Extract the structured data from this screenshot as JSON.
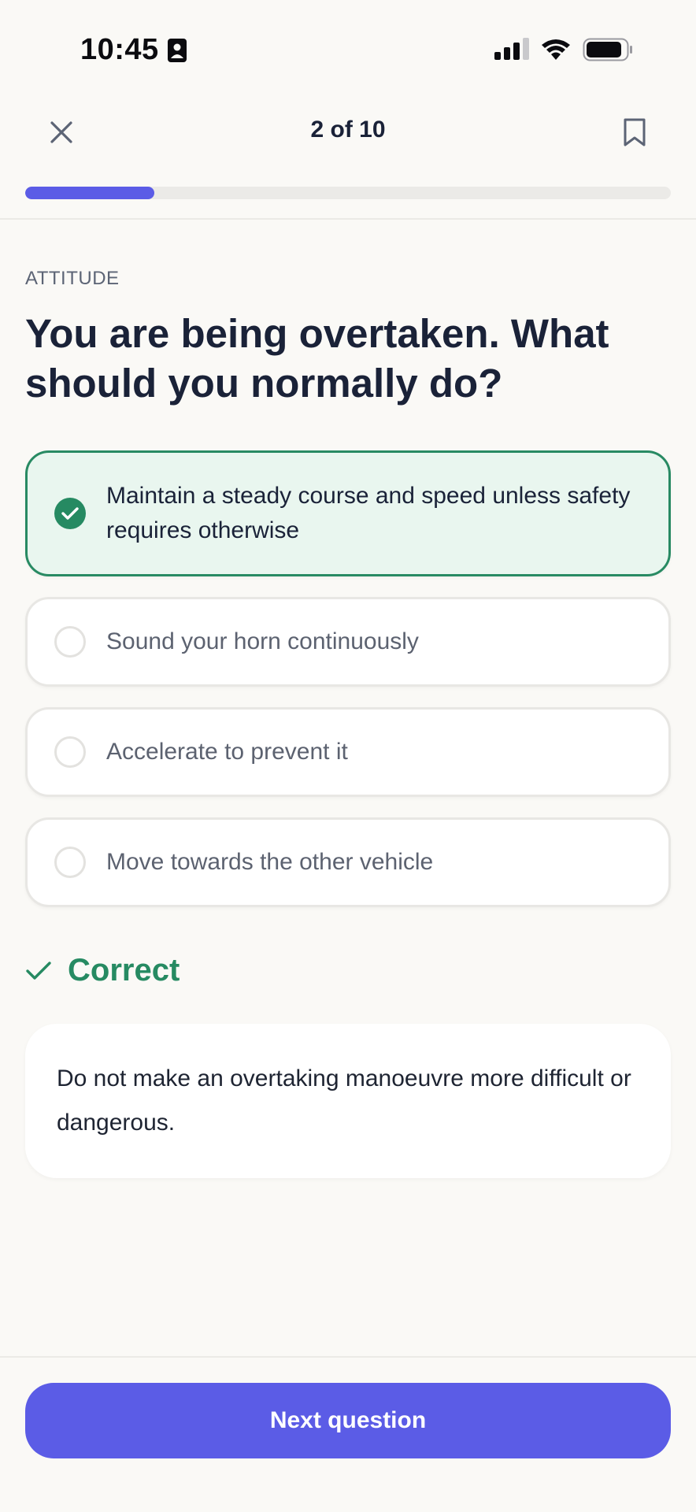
{
  "status_bar": {
    "time": "10:45",
    "icons": [
      "id-card-icon",
      "signal-icon",
      "wifi-icon",
      "battery-icon"
    ]
  },
  "header": {
    "counter": "2 of 10",
    "close_icon": "close-icon",
    "bookmark_icon": "bookmark-icon"
  },
  "progress": {
    "current": 2,
    "total": 10,
    "fraction": 0.2,
    "color": "#5b5ce6"
  },
  "question": {
    "category": "ATTITUDE",
    "text": "You are being overtaken. What should you normally do?"
  },
  "options": [
    {
      "label": "Maintain a steady course and speed unless safety requires otherwise",
      "state": "correct"
    },
    {
      "label": "Sound your horn continuously",
      "state": "unselected"
    },
    {
      "label": "Accelerate to prevent it",
      "state": "unselected"
    },
    {
      "label": "Move towards the other vehicle",
      "state": "unselected"
    }
  ],
  "result": {
    "label": "Correct",
    "color": "#268a62",
    "explanation": "Do not make an overtaking manoeuvre more difficult or dangerous."
  },
  "footer": {
    "next_label": "Next question",
    "accent": "#5b5ce6"
  }
}
